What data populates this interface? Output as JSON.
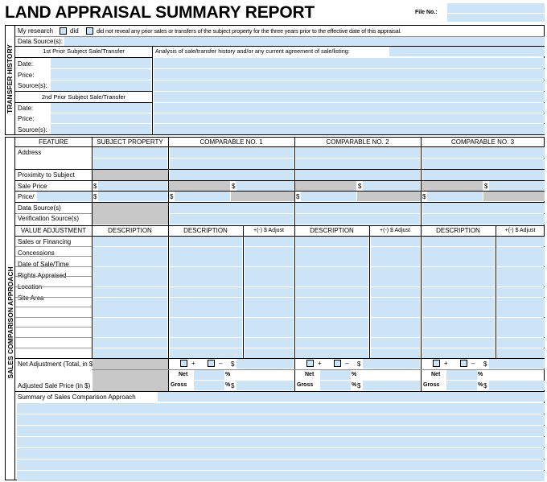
{
  "header": {
    "title": "LAND APPRAISAL SUMMARY REPORT",
    "file_no_label": "File No.:"
  },
  "transfer_history": {
    "section_label": "TRANSFER HISTORY",
    "research_prefix": "My research",
    "did_label": "did",
    "did_not_label": "did not reveal any prior sales or transfers of the subject property for the three years prior to the effective date of this appraisal.",
    "data_sources_label": "Data Source(s):",
    "first_prior_label": "1st Prior Subject Sale/Transfer",
    "second_prior_label": "2nd Prior Subject Sale/Transfer",
    "analysis_label": "Analysis of sale/transfer history and/or any current agreement of sale/listing:",
    "date_label": "Date:",
    "price_label": "Price:",
    "source_label": "Source(s):"
  },
  "sales_comparison": {
    "section_label": "SALES COMPARISON APPROACH",
    "headers": {
      "feature": "FEATURE",
      "subject": "SUBJECT PROPERTY",
      "comp1": "COMPARABLE NO. 1",
      "comp2": "COMPARABLE NO. 2",
      "comp3": "COMPARABLE NO. 3"
    },
    "rows": {
      "address": "Address",
      "proximity": "Proximity to Subject",
      "sale_price": "Sale Price",
      "price_per": "Price/",
      "data_sources": "Data Source(s)",
      "verification": "Verification Source(s)"
    },
    "currency": "$",
    "adj_headers": {
      "value_adjustment": "VALUE ADJUSTMENT",
      "description": "DESCRIPTION",
      "adjust": "+(-) $ Adjust"
    },
    "adj_rows": [
      "Sales or Financing",
      "Concessions",
      "Date of Sale/Time",
      "Rights Appraised",
      "Location",
      "Site Area"
    ],
    "net_adjustment_label": "Net Adjustment (Total, in $)",
    "plus": "+",
    "minus": "–",
    "adjusted_price_label": "Adjusted Sale Price (in $)",
    "net_label": "Net",
    "gross_label": "Gross",
    "percent": "%",
    "summary_label": "Summary of Sales Comparison Approach"
  }
}
